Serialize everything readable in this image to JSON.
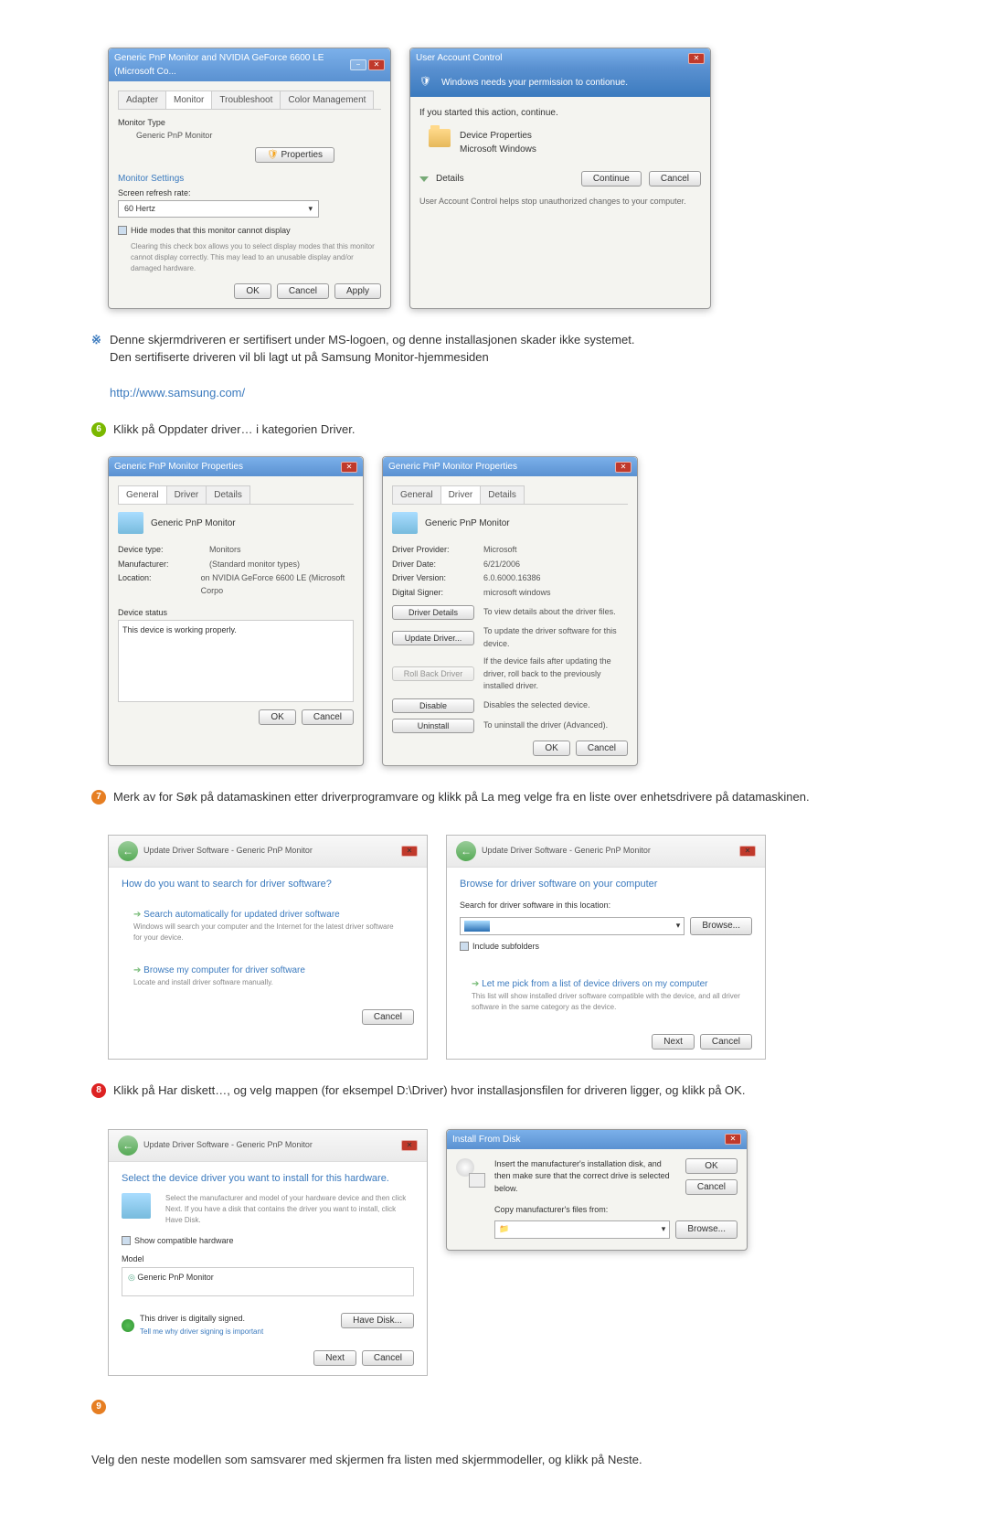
{
  "monitor_dialog": {
    "title": "Generic PnP Monitor and NVIDIA GeForce 6600 LE (Microsoft Co...",
    "tabs": [
      "Adapter",
      "Monitor",
      "Troubleshoot",
      "Color Management"
    ],
    "monitor_type_heading": "Monitor Type",
    "monitor_name": "Generic PnP Monitor",
    "properties_btn": "Properties",
    "settings_heading": "Monitor Settings",
    "refresh_label": "Screen refresh rate:",
    "refresh_value": "60 Hertz",
    "hide_modes_label": "Hide modes that this monitor cannot display",
    "hide_modes_desc": "Clearing this check box allows you to select display modes that this monitor cannot display correctly. This may lead to an unusable display and/or damaged hardware.",
    "ok": "OK",
    "cancel": "Cancel",
    "apply": "Apply"
  },
  "uac": {
    "title": "User Account Control",
    "headline": "Windows needs your permission to contionue.",
    "started_text": "If you started this action, continue.",
    "device_props": "Device Properties",
    "ms_windows": "Microsoft Windows",
    "details": "Details",
    "continue": "Continue",
    "cancel": "Cancel",
    "footer": "User Account Control helps stop unauthorized changes to your computer."
  },
  "note1_a": "Denne skjermdriveren er sertifisert under MS-logoen, og denne installasjonen skader ikke systemet.",
  "note1_b": "Den sertifiserte driveren vil bli lagt ut på Samsung Monitor-hjemmesiden",
  "samsung_url": "http://www.samsung.com/",
  "step6_text": "Klikk på Oppdater driver… i kategorien Driver.",
  "props_general": {
    "title": "Generic PnP Monitor Properties",
    "tabs": [
      "General",
      "Driver",
      "Details"
    ],
    "name": "Generic PnP Monitor",
    "device_type_k": "Device type:",
    "device_type_v": "Monitors",
    "manufacturer_k": "Manufacturer:",
    "manufacturer_v": "(Standard monitor types)",
    "location_k": "Location:",
    "location_v": "on NVIDIA GeForce 6600 LE (Microsoft Corpo",
    "device_status_label": "Device status",
    "status_text": "This device is working properly.",
    "ok": "OK",
    "cancel": "Cancel"
  },
  "props_driver": {
    "title": "Generic PnP Monitor Properties",
    "tabs": [
      "General",
      "Driver",
      "Details"
    ],
    "name": "Generic PnP Monitor",
    "provider_k": "Driver Provider:",
    "provider_v": "Microsoft",
    "date_k": "Driver Date:",
    "date_v": "6/21/2006",
    "version_k": "Driver Version:",
    "version_v": "6.0.6000.16386",
    "signer_k": "Digital Signer:",
    "signer_v": "microsoft windows",
    "btn_details": "Driver Details",
    "desc_details": "To view details about the driver files.",
    "btn_update": "Update Driver...",
    "desc_update": "To update the driver software for this device.",
    "btn_rollback": "Roll Back Driver",
    "desc_rollback": "If the device fails after updating the driver, roll back to the previously installed driver.",
    "btn_disable": "Disable",
    "desc_disable": "Disables the selected device.",
    "btn_uninstall": "Uninstall",
    "desc_uninstall": "To uninstall the driver (Advanced).",
    "ok": "OK",
    "cancel": "Cancel"
  },
  "step7_text": "Merk av for Søk på datamaskinen etter driverprogramvare og klikk på La meg velge fra en liste over enhetsdrivere på datamaskinen.",
  "wizard1": {
    "header": "Update Driver Software - Generic PnP Monitor",
    "title": "How do you want to search for driver software?",
    "opt1_title": "Search automatically for updated driver software",
    "opt1_desc": "Windows will search your computer and the Internet for the latest driver software for your device.",
    "opt2_title": "Browse my computer for driver software",
    "opt2_desc": "Locate and install driver software manually.",
    "cancel": "Cancel"
  },
  "wizard2": {
    "header": "Update Driver Software - Generic PnP Monitor",
    "title": "Browse for driver software on your computer",
    "search_label": "Search for driver software in this location:",
    "browse_btn": "Browse...",
    "include_sub": "Include subfolders",
    "opt_title": "Let me pick from a list of device drivers on my computer",
    "opt_desc": "This list will show installed driver software compatible with the device, and all driver software in the same category as the device.",
    "next": "Next",
    "cancel": "Cancel"
  },
  "step8_text": "Klikk på Har diskett…, og velg mappen (for eksempel D:\\Driver) hvor installasjonsfilen for driveren ligger, og klikk på OK.",
  "wizard3": {
    "header": "Update Driver Software - Generic PnP Monitor",
    "title": "Select the device driver you want to install for this hardware.",
    "subtitle": "Select the manufacturer and model of your hardware device and then click Next. If you have a disk that contains the driver you want to install, click Have Disk.",
    "show_compat": "Show compatible hardware",
    "model_label": "Model",
    "model_item": "Generic PnP Monitor",
    "signed_text": "This driver is digitally signed.",
    "tell_me": "Tell me why driver signing is important",
    "have_disk": "Have Disk...",
    "next": "Next",
    "cancel": "Cancel"
  },
  "install_disk": {
    "title": "Install From Disk",
    "text": "Insert the manufacturer's installation disk, and then make sure that the correct drive is selected below.",
    "copy_label": "Copy manufacturer's files from:",
    "ok": "OK",
    "cancel": "Cancel",
    "browse": "Browse..."
  },
  "step_final": "Velg den neste modellen som samsvarer med skjermen fra listen med skjermmodeller, og klikk på Neste."
}
